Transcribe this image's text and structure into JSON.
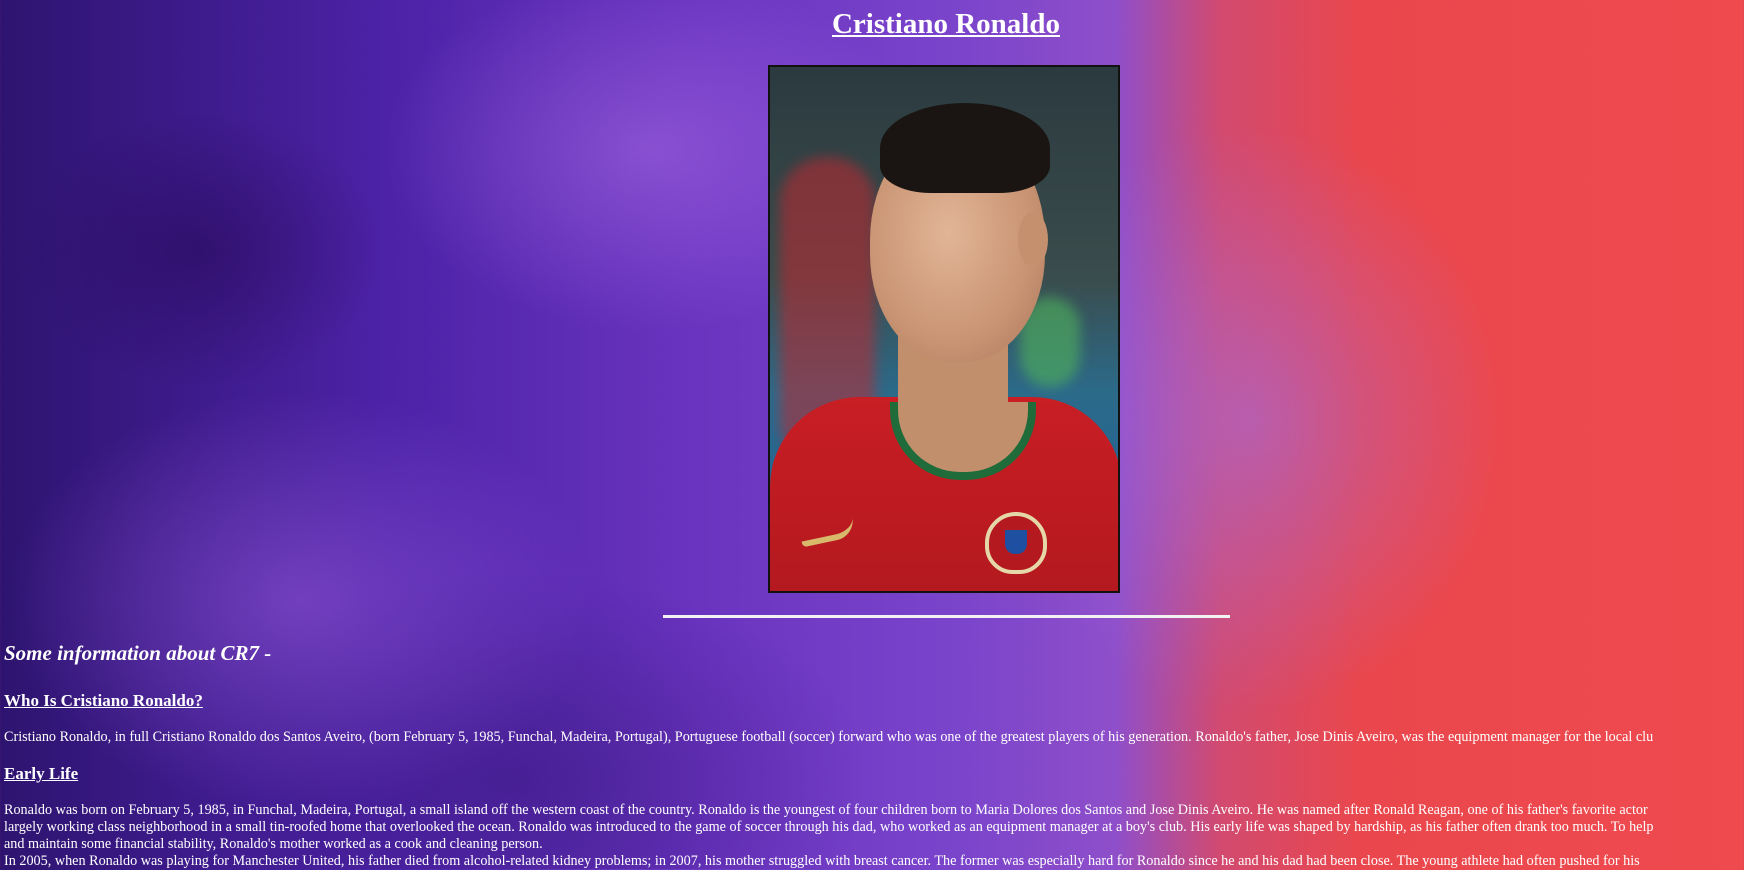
{
  "title": "Cristiano Ronaldo",
  "photo": {
    "alt": "Cristiano Ronaldo in Portugal national team shirt"
  },
  "intro_heading": "Some information about CR7 -",
  "sections": [
    {
      "heading": "Who Is Cristiano Ronaldo?",
      "lines": [
        "Cristiano Ronaldo, in full Cristiano Ronaldo dos Santos Aveiro, (born February 5, 1985, Funchal, Madeira, Portugal), Portuguese football (soccer) forward who was one of the greatest players of his generation. Ronaldo's father, Jose Dinis Aveiro, was the equipment manager for the local clu"
      ]
    },
    {
      "heading": "Early Life",
      "lines": [
        "Ronaldo was born on February 5, 1985, in Funchal, Madeira, Portugal, a small island off the western coast of the country. Ronaldo is the youngest of four children born to Maria Dolores dos Santos and Jose Dinis Aveiro. He was named after Ronald Reagan, one of his father's favorite actor",
        "largely working class neighborhood in a small tin-roofed home that overlooked the ocean. Ronaldo was introduced to the game of soccer through his dad, who worked as an equipment manager at a boy's club. His early life was shaped by hardship, as his father often drank too much. To help",
        "and maintain some financial stability, Ronaldo's mother worked as a cook and cleaning person.",
        "In 2005, when Ronaldo was playing for Manchester United, his father died from alcohol-related kidney problems; in 2007, his mother struggled with breast cancer. The former was especially hard for Ronaldo since he and his dad had been close. The young athlete had often pushed for his"
      ]
    }
  ]
}
